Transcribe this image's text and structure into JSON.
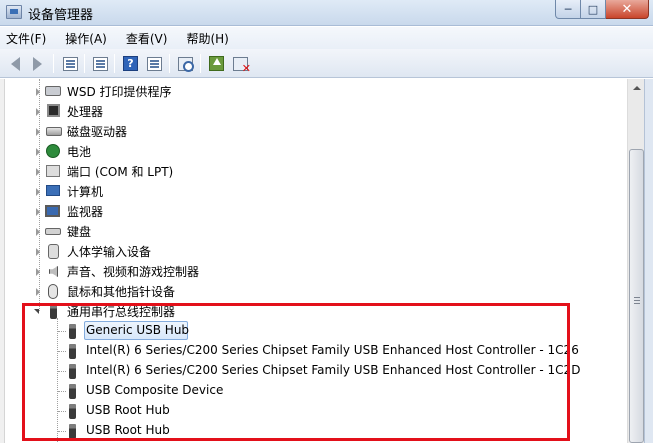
{
  "window": {
    "title": "设备管理器",
    "controls": {
      "minimize": "─",
      "maximize": "□",
      "close": "✕"
    }
  },
  "menu": [
    "文件(F)",
    "操作(A)",
    "查看(V)",
    "帮助(H)"
  ],
  "toolbar": {
    "icons": [
      "back-arrow-icon",
      "forward-arrow-icon",
      "show-hide-console-tree-icon",
      "properties-icon",
      "help-icon",
      "action-pane-icon",
      "scan-hardware-icon",
      "update-driver-icon",
      "uninstall-icon"
    ],
    "help_glyph": "?"
  },
  "tree": {
    "categories": [
      {
        "label": "WSD 打印提供程序",
        "icon": "printer-icon"
      },
      {
        "label": "处理器",
        "icon": "processor-icon"
      },
      {
        "label": "磁盘驱动器",
        "icon": "disk-drive-icon"
      },
      {
        "label": "电池",
        "icon": "battery-icon"
      },
      {
        "label": "端口 (COM 和 LPT)",
        "icon": "port-icon"
      },
      {
        "label": "计算机",
        "icon": "computer-icon"
      },
      {
        "label": "监视器",
        "icon": "monitor-icon"
      },
      {
        "label": "键盘",
        "icon": "keyboard-icon"
      },
      {
        "label": "人体学输入设备",
        "icon": "hid-icon"
      },
      {
        "label": "声音、视频和游戏控制器",
        "icon": "sound-icon"
      },
      {
        "label": "鼠标和其他指针设备",
        "icon": "mouse-icon"
      }
    ],
    "usb_category": {
      "label": "通用串行总线控制器",
      "expanded": true,
      "children": [
        {
          "label": "Generic USB Hub",
          "selected": true
        },
        {
          "label": "Intel(R) 6 Series/C200 Series Chipset Family USB Enhanced Host Controller - 1C26"
        },
        {
          "label": "Intel(R) 6 Series/C200 Series Chipset Family USB Enhanced Host Controller - 1C2D"
        },
        {
          "label": "USB Composite Device"
        },
        {
          "label": "USB Root Hub"
        },
        {
          "label": "USB Root Hub"
        }
      ]
    }
  },
  "colors": {
    "highlight_border": "#e3101a",
    "selection_fill": "#d7e7fa",
    "selection_border": "#84acdd"
  }
}
